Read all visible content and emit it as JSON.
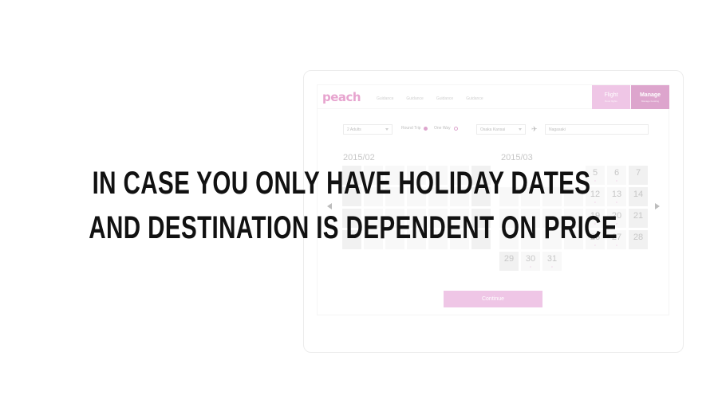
{
  "caption": {
    "line1": "IN CASE YOU ONLY HAVE HOLIDAY DATES",
    "line2": "AND DESTINATION IS DEPENDENT ON PRICE"
  },
  "app": {
    "logo": "peach",
    "nav": [
      "Guidance",
      "Guidance",
      "Guidance",
      "Guidance"
    ],
    "flight_button": {
      "title": "Flight",
      "sub": "Book flights"
    },
    "manage_button": {
      "title": "Manage",
      "sub": "Manage booking"
    }
  },
  "search": {
    "passengers": "2 Adults",
    "round_trip_label": "Round Trip",
    "one_way_label": "One Way",
    "trip_type_selected": "Round Trip",
    "origin": "Osaka Kansai",
    "destination": "Nagasaki"
  },
  "calendar": {
    "month1": "2015/02",
    "month2": "2015/03",
    "month2_visible_days": [
      "5",
      "6",
      "7",
      "12",
      "13",
      "14",
      "19",
      "20",
      "21",
      "26",
      "27",
      "28",
      "29",
      "30",
      "31"
    ]
  },
  "continue_label": "Continue",
  "colors": {
    "brand": "#c35ca6",
    "brand_light": "#e398d3"
  },
  "icons": [
    "plane-icon",
    "chevron-left-icon",
    "chevron-right-icon"
  ]
}
